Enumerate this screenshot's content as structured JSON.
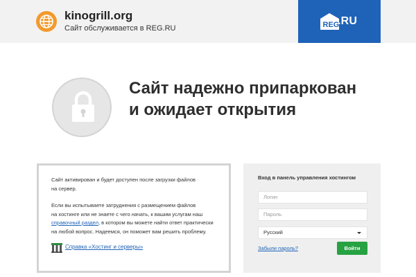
{
  "header": {
    "site_name": "kinogrill.org",
    "subtitle": "Сайт обслуживается в REG.RU",
    "brand_logo_text": "REG.RU",
    "brand_color": "#1f63b8"
  },
  "hero": {
    "headline_line1": "Сайт надежно припаркован",
    "headline_line2": "и ожидает открытия",
    "icon": "lock-icon"
  },
  "info": {
    "paragraph1_line1": "Сайт активирован и будет доступен после загрузки файлов",
    "paragraph1_line2": "на сервер.",
    "paragraph2_line1": "Если вы испытываете затруднения с размещением файлов",
    "paragraph2_line2": "на хостинге или не знаете с чего начать, к вашим услугам наш",
    "paragraph2_link": "справочный раздел",
    "paragraph2_line3_rest": ", в котором вы можете найти ответ практически",
    "paragraph2_line4": "на любой вопрос. Надеемся, он поможет вам решить проблему.",
    "help_link": "Справка «Хостинг и серверы»"
  },
  "login": {
    "title": "Вход в панель управления хостингом",
    "login_placeholder": "Логин",
    "password_placeholder": "Пароль",
    "language_selected": "Русский",
    "forgot_link": "Забыли пароль?",
    "submit_label": "Войти",
    "submit_color": "#27a243"
  }
}
